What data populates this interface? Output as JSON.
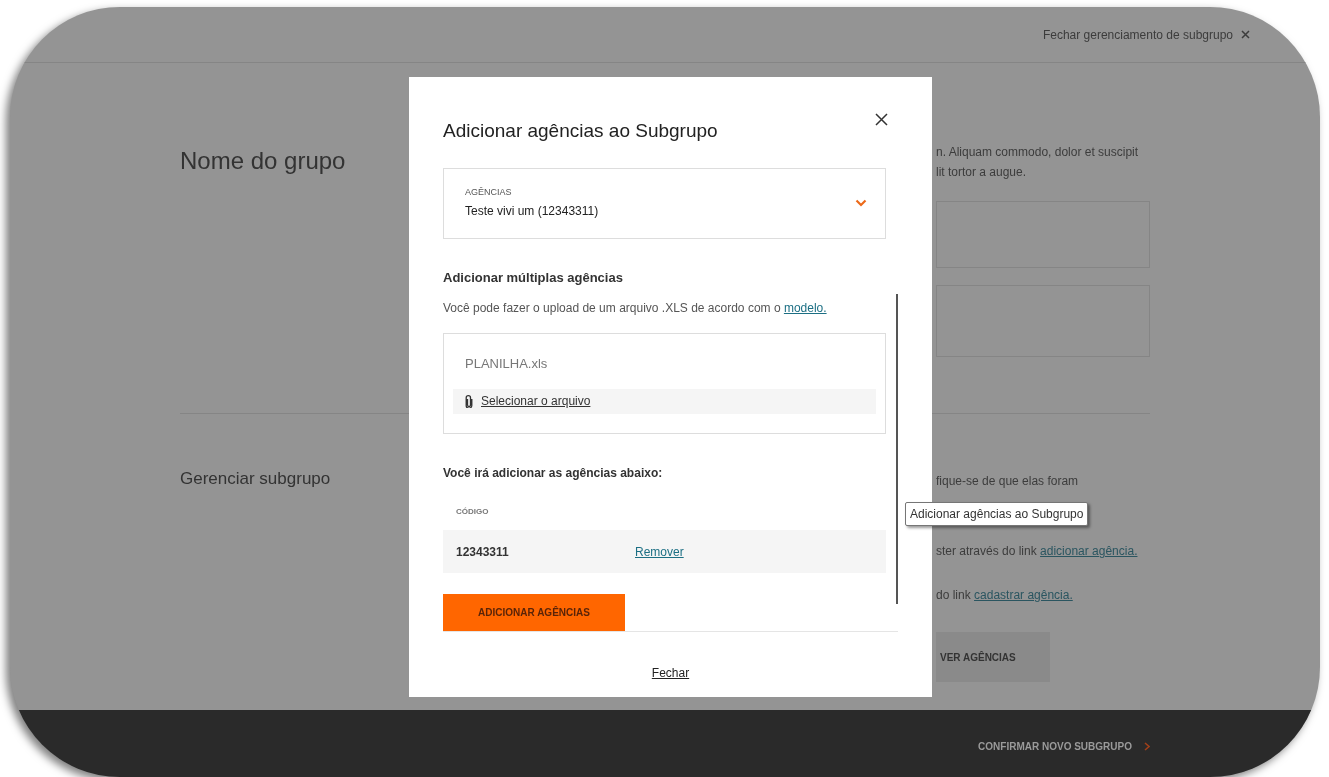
{
  "header": {
    "close_label": "Fechar gerenciamento de subgrupo"
  },
  "sections": [
    {
      "title": "Nome do grupo",
      "lines": [
        {
          "text": "n. Aliquam commodo, dolor et suscipit"
        },
        {
          "text": "lit tortor a augue."
        }
      ]
    },
    {
      "title": "Gerenciar subgrupo",
      "lines": [
        {
          "text": "fique-se de que elas foram"
        },
        {
          "text": "ster através do link",
          "link": "adicionar agência."
        },
        {
          "text": "do link",
          "link": "cadastrar agência."
        }
      ],
      "button": "VER AGÊNCIAS"
    }
  ],
  "footer": {
    "confirm_label": "CONFIRMAR NOVO SUBGRUPO"
  },
  "modal": {
    "title": "Adicionar agências ao Subgrupo",
    "dropdown": {
      "label": "AGÊNCIAS",
      "value": "Teste vivi um (12343311)"
    },
    "multiple": {
      "heading": "Adicionar múltiplas agências",
      "text": "Você pode fazer o upload de um arquivo .XLS de acordo com o",
      "link": "modelo."
    },
    "upload": {
      "filename": "PLANILHA.xls",
      "select_label": "Selecionar o arquivo"
    },
    "list": {
      "heading": "Você irá adicionar as agências abaixo:",
      "column": "CÓDIGO",
      "rows": [
        {
          "code": "12343311",
          "action": "Remover"
        }
      ]
    },
    "primary_button": "ADICIONAR AGÊNCIAS",
    "close_link": "Fechar"
  },
  "tooltip": {
    "text": "Adicionar agências ao Subgrupo"
  }
}
